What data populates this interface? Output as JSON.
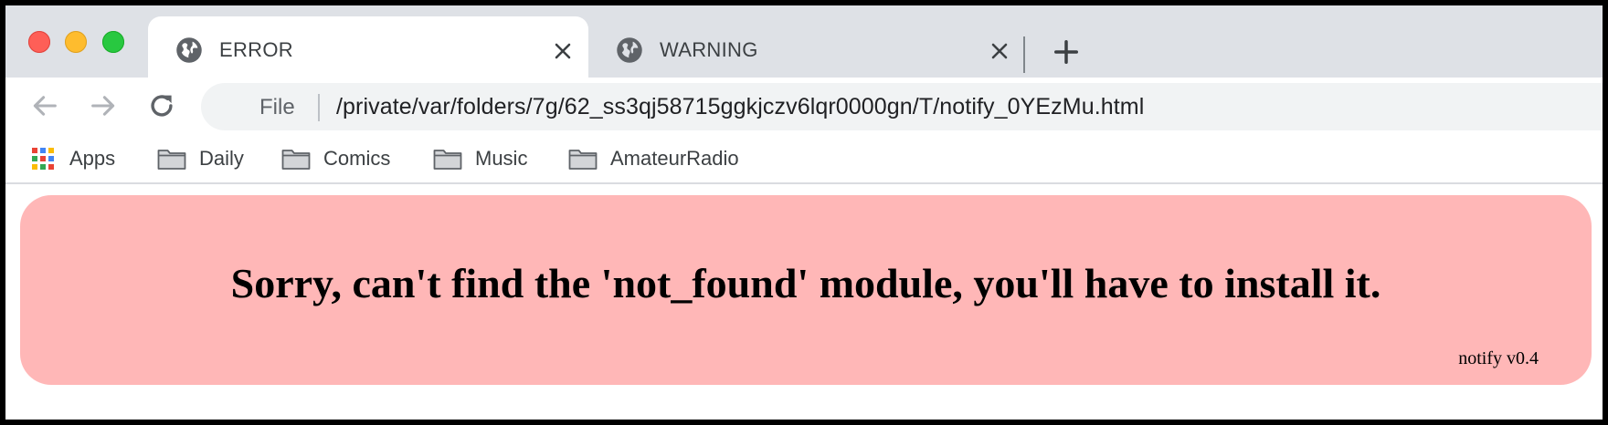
{
  "window": {
    "controls": [
      "close",
      "minimize",
      "zoom"
    ]
  },
  "tabs": [
    {
      "title": "ERROR",
      "icon": "globe-icon",
      "active": true
    },
    {
      "title": "WARNING",
      "icon": "globe-icon",
      "active": false
    }
  ],
  "toolbar": {
    "scheme_label": "File",
    "url": "/private/var/folders/7g/62_ss3qj58715ggkjczv6lqr0000gn/T/notify_0YEzMu.html"
  },
  "bookmarks": [
    {
      "label": "Apps",
      "icon": "apps-grid-icon"
    },
    {
      "label": "Daily",
      "icon": "folder-icon"
    },
    {
      "label": "Comics",
      "icon": "folder-icon"
    },
    {
      "label": "Music",
      "icon": "folder-icon"
    },
    {
      "label": "AmateurRadio",
      "icon": "folder-icon"
    }
  ],
  "page": {
    "message": "Sorry, can't find the 'not_found' module, you'll have to install it.",
    "version": "notify v0.4",
    "background_color": "#ffb7b7"
  },
  "colors": {
    "tabstrip": "#dee1e6",
    "close": "#fe5f57",
    "minimize": "#febc2e",
    "zoom": "#28c840"
  }
}
